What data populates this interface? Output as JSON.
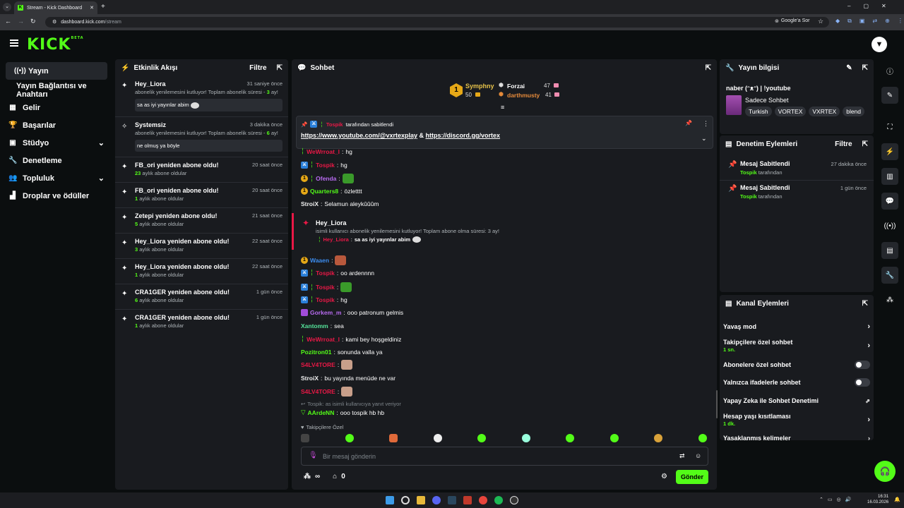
{
  "browser": {
    "tab_title": "Stream - Kick Dashboard",
    "new_tab": "+",
    "url_host": "dashboard.kick.com",
    "url_path": "/stream",
    "google_label": "Google'a Sor"
  },
  "header": {
    "logo": "KICK",
    "logo_sup": "BETA"
  },
  "nav": {
    "items": [
      {
        "label": "Yayın",
        "icon": "((•))"
      },
      {
        "label": "Yayın Bağlantısı ve Anahtarı",
        "icon": ""
      },
      {
        "label": "Gelir",
        "icon": "▦"
      },
      {
        "label": "Başarılar",
        "icon": "🏆"
      },
      {
        "label": "Stüdyo",
        "icon": "▣"
      },
      {
        "label": "Denetleme",
        "icon": "🔧"
      },
      {
        "label": "Topluluk",
        "icon": "👥"
      },
      {
        "label": "Droplar ve ödüller",
        "icon": "▟"
      }
    ]
  },
  "activity": {
    "title": "Etkinlik Akışı",
    "filter": "Filtre",
    "items": [
      {
        "name": "Hey_Liora",
        "time": "31 saniye önce",
        "sub_a": "abonelik yenilemesini kutluyor! Toplam abonelik süresi - ",
        "sub_num": "3",
        "sub_b": " ay!",
        "msg": "sa as iyi yayınlar abim"
      },
      {
        "name": "Systemsiz",
        "time": "3 dakika önce",
        "sub_a": "abonelik yenilemesini kutluyor! Toplam abonelik süresi - ",
        "sub_num": "6",
        "sub_b": " ay!",
        "msg": "ne olmuş ya böyle"
      },
      {
        "name": "FB_ori yeniden abone oldu!",
        "time": "20 saat önce",
        "num": "23",
        "unit": " aylık abone oldular"
      },
      {
        "name": "FB_ori yeniden abone oldu!",
        "time": "20 saat önce",
        "num": "1",
        "unit": " aylık abone oldular"
      },
      {
        "name": "Zetepi yeniden abone oldu!",
        "time": "21 saat önce",
        "num": "5",
        "unit": " aylık abone oldular"
      },
      {
        "name": "Hey_Liora yeniden abone oldu!",
        "time": "22 saat önce",
        "num": "3",
        "unit": " aylık abone oldular"
      },
      {
        "name": "Hey_Liora yeniden abone oldu!",
        "time": "22 saat önce",
        "num": "1",
        "unit": " aylık abone oldular"
      },
      {
        "name": "CRA1GER yeniden abone oldu!",
        "time": "1 gün önce",
        "num": "6",
        "unit": " aylık abone oldular"
      },
      {
        "name": "CRA1GER yeniden abone oldu!",
        "time": "1 gün önce",
        "num": "1",
        "unit": " aylık abone oldular"
      }
    ]
  },
  "chat": {
    "title": "Sohbet",
    "leaderboard": [
      {
        "rank": "1",
        "name": "Symphny",
        "value": "50"
      },
      {
        "name": "Forzai",
        "value": "47"
      },
      {
        "name": "darthmusty",
        "value": "41"
      }
    ],
    "pinned": {
      "by_user": "Tospik",
      "by_text": "tarafından sabitlendi",
      "link1": "https://www.youtube.com/@vxrtexplay",
      "amp": "&",
      "link2": "https://discord.gg/vortex"
    },
    "lines": [
      {
        "user": "WeWrroat_l",
        "text": "hg"
      },
      {
        "user": "Tospik",
        "text": "hg"
      },
      {
        "user": "Ofenda",
        "text": ""
      },
      {
        "user": "Quarters8",
        "text": "özletttt"
      },
      {
        "user": "StroiX",
        "text": "Selamun aleykûûûm"
      },
      {
        "user": "Waaen",
        "text": ""
      },
      {
        "user": "Tospik",
        "text": "oo ardennnn"
      },
      {
        "user": "Tospik",
        "text": ""
      },
      {
        "user": "Tospik",
        "text": "hg"
      },
      {
        "user": "Gorkem_m",
        "text": "ooo patronum gelmis"
      },
      {
        "user": "Xantomm",
        "text": "sea"
      },
      {
        "user": "WeWrroat_l",
        "text": "kami bey hoşgeldiniz"
      },
      {
        "user": "Pozitron01",
        "text": "sonunda valla ya"
      },
      {
        "user": "S4LV4TORE",
        "text": ""
      },
      {
        "user": "StroiX",
        "text": "bu yayında menüde ne var"
      },
      {
        "user": "S4LV4TORE",
        "text": ""
      },
      {
        "user": "AArdeNN",
        "text": "ooo tospik hb hb"
      }
    ],
    "sub_event": {
      "name": "Hey_Liora",
      "sub": "isimli kullanıcı abonelik yenilemesini kutluyor! Toplam abone olma süresi: 3 ay!",
      "reply_user": "Hey_Liora",
      "reply_text": "sa as iyi yayınlar abim"
    },
    "reply_note": "Tospik: as isimli kullanıcıya yanıt veriyor",
    "emote_label": "Takipçilere Özel",
    "input_placeholder": "Bir mesaj gönderin",
    "infinity": "∞",
    "count": "0",
    "send": "Gönder"
  },
  "stream_info": {
    "title": "Yayın bilgisi",
    "stream_title": "naber (ᵔᴥᵔ) | !youtube",
    "category": "Sadece Sohbet",
    "tags": [
      "Turkish",
      "VORTEX",
      "VXRTEX",
      "blend"
    ]
  },
  "mod_actions": {
    "title": "Denetim Eylemleri",
    "filter": "Filtre",
    "items": [
      {
        "label": "Mesaj Sabitlendi",
        "user": "Tospik",
        "by": " tarafından",
        "time": "27 dakika önce"
      },
      {
        "label": "Mesaj Sabitlendi",
        "user": "Tospik",
        "by": " tarafından",
        "time": "1 gün önce"
      }
    ]
  },
  "channel_actions": {
    "title": "Kanal Eylemleri",
    "items": [
      {
        "label": "Yavaş mod"
      },
      {
        "label": "Takipçilere özel sohbet",
        "sub": "1 sn."
      },
      {
        "label": "Abonelere özel sohbet"
      },
      {
        "label": "Yalnızca ifadelerle sohbet"
      },
      {
        "label": "Yapay Zeka ile Sohbet Denetimi"
      },
      {
        "label": "Hesap yaşı kısıtlaması",
        "sub": "1 dk."
      },
      {
        "label": "Yasaklanmış kelimeler"
      }
    ]
  },
  "taskbar": {
    "time": "16:31",
    "date": "16.03.2026"
  },
  "colors": {
    "accent": "#53fc18",
    "panel": "#191b1f",
    "bg": "#0b0e0f",
    "mod_red": "#e91846"
  }
}
